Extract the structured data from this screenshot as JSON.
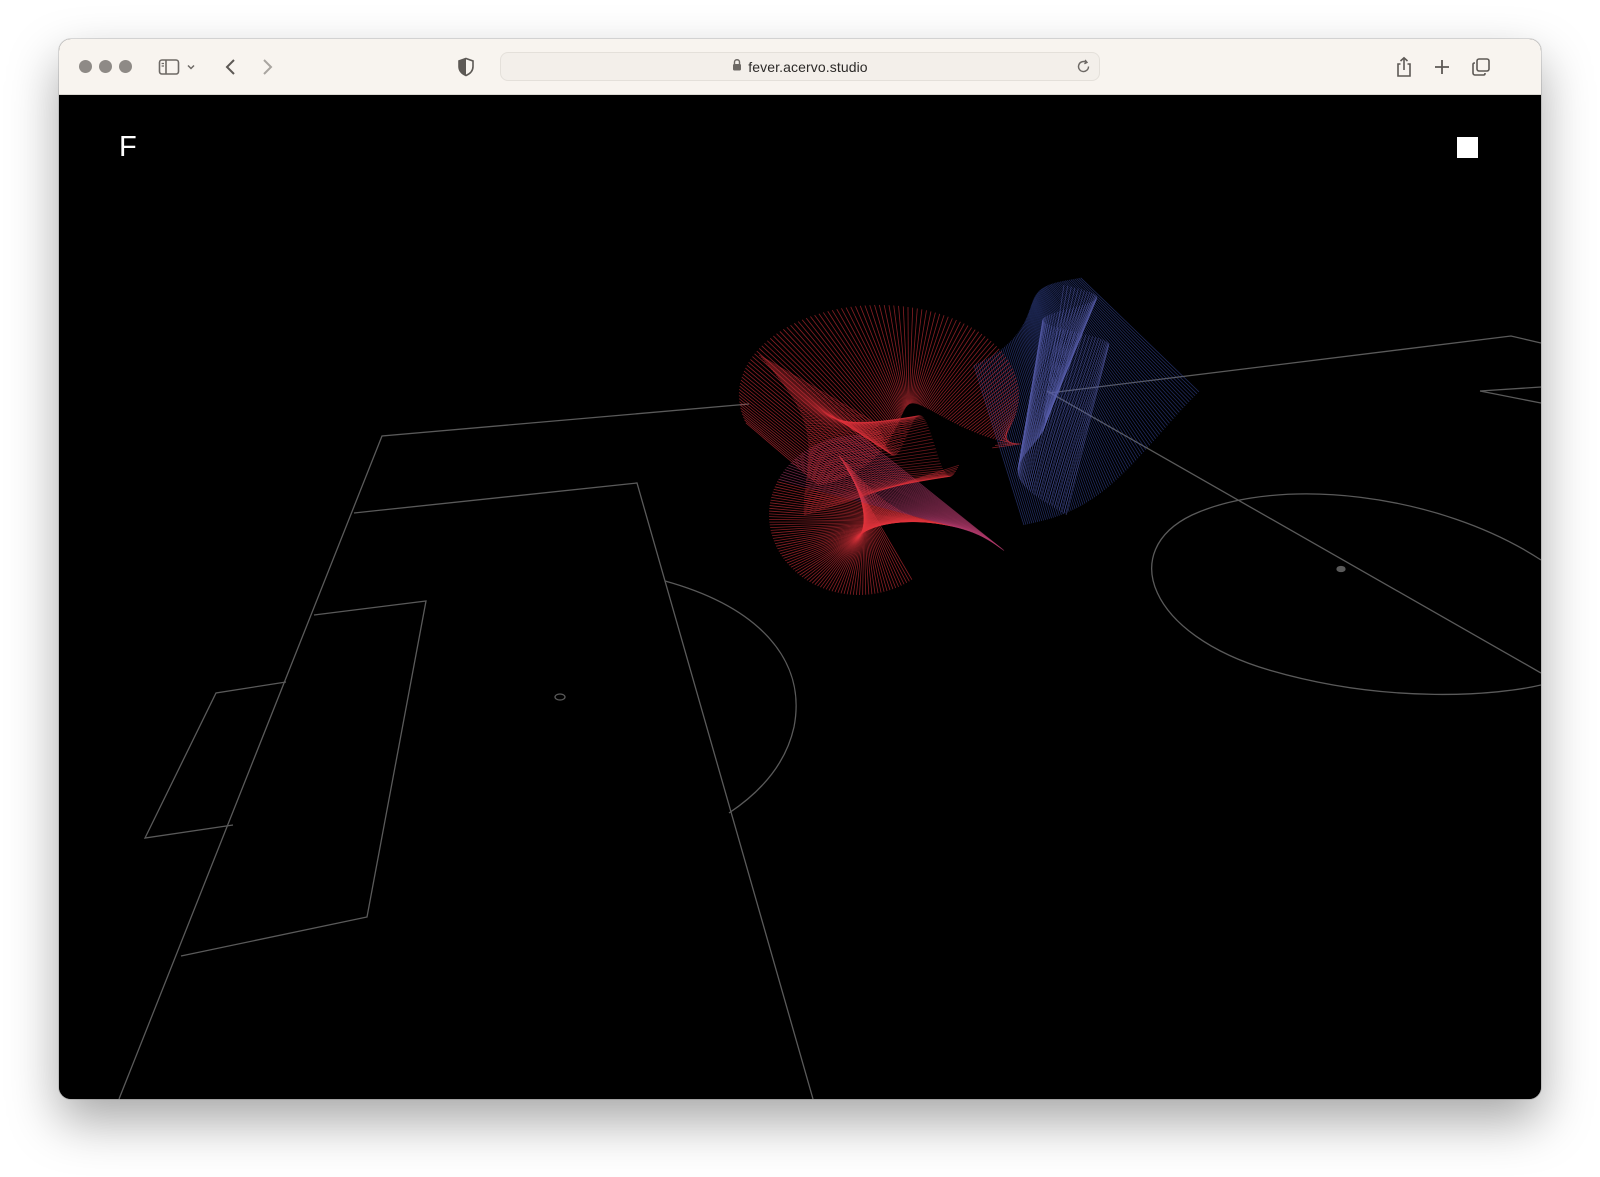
{
  "browser": {
    "url": "fever.acervo.studio",
    "controls": {
      "back_icon": "chevron-left-icon",
      "forward_icon": "chevron-right-icon",
      "sidebar_icon": "sidebar-icon",
      "shield_icon": "shield-icon",
      "lock_icon": "lock-icon",
      "reload_icon": "reload-icon",
      "share_icon": "share-icon",
      "new_tab_icon": "plus-icon",
      "tabs_icon": "tabs-overview-icon"
    }
  },
  "page": {
    "logo": "F",
    "menu_icon": "square-icon"
  },
  "colors": {
    "toolbar_bg": "#f8f4ef",
    "page_bg": "#000000",
    "pitch_lines": "#5a5a5a",
    "ribbon_red": "#e0343c",
    "ribbon_blue": "#3a4fa8"
  }
}
